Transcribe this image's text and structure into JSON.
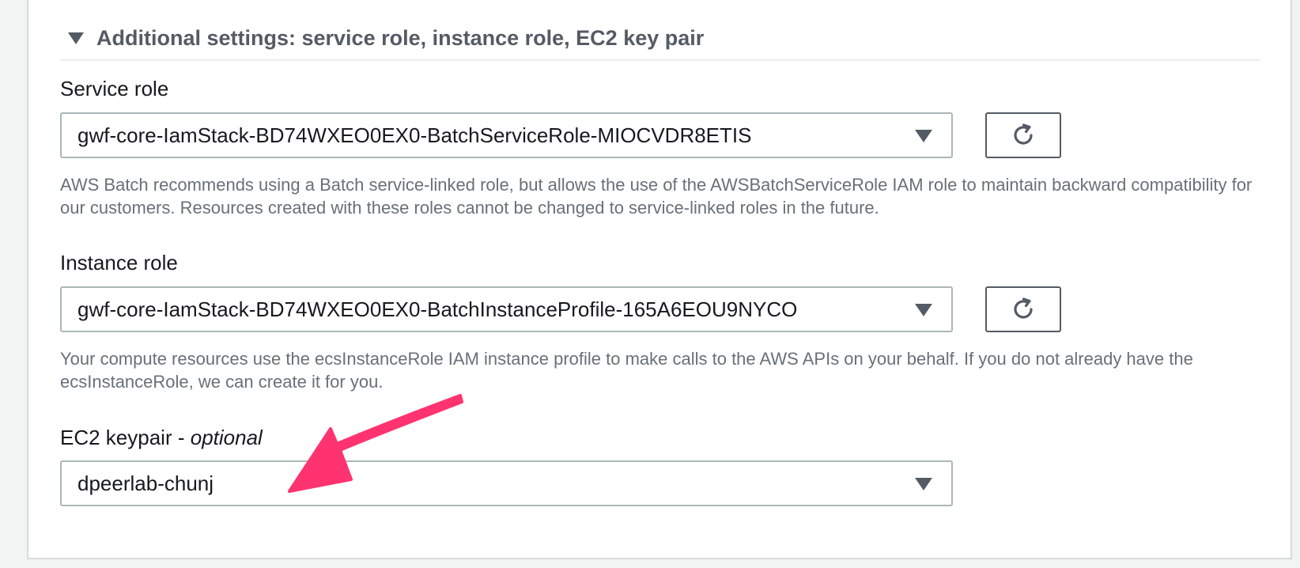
{
  "section": {
    "title": "Additional settings: service role, instance role, EC2 key pair",
    "expand_icon": "caret-down-icon"
  },
  "service_role": {
    "label": "Service role",
    "value": "gwf-core-IamStack-BD74WXEO0EX0-BatchServiceRole-MIOCVDR8ETIS",
    "description": "AWS Batch recommends using a Batch service-linked role, but allows the use of the AWSBatchServiceRole IAM role to maintain backward compatibility for our customers. Resources created with these roles cannot be changed to service-linked roles in the future.",
    "refresh_icon": "refresh-icon"
  },
  "instance_role": {
    "label": "Instance role",
    "value": "gwf-core-IamStack-BD74WXEO0EX0-BatchInstanceProfile-165A6EOU9NYCO",
    "description": "Your compute resources use the ecsInstanceRole IAM instance profile to make calls to the AWS APIs on your behalf. If you do not already have the ecsInstanceRole, we can create it for you.",
    "refresh_icon": "refresh-icon"
  },
  "ec2_keypair": {
    "label": "EC2 keypair - ",
    "label_optional": "optional",
    "value": "dpeerlab-chunj"
  },
  "colors": {
    "annotation_arrow": "#ff3370",
    "panel_border": "#d5dbdb",
    "input_border": "#aab7b8",
    "secondary_text": "#687078"
  }
}
